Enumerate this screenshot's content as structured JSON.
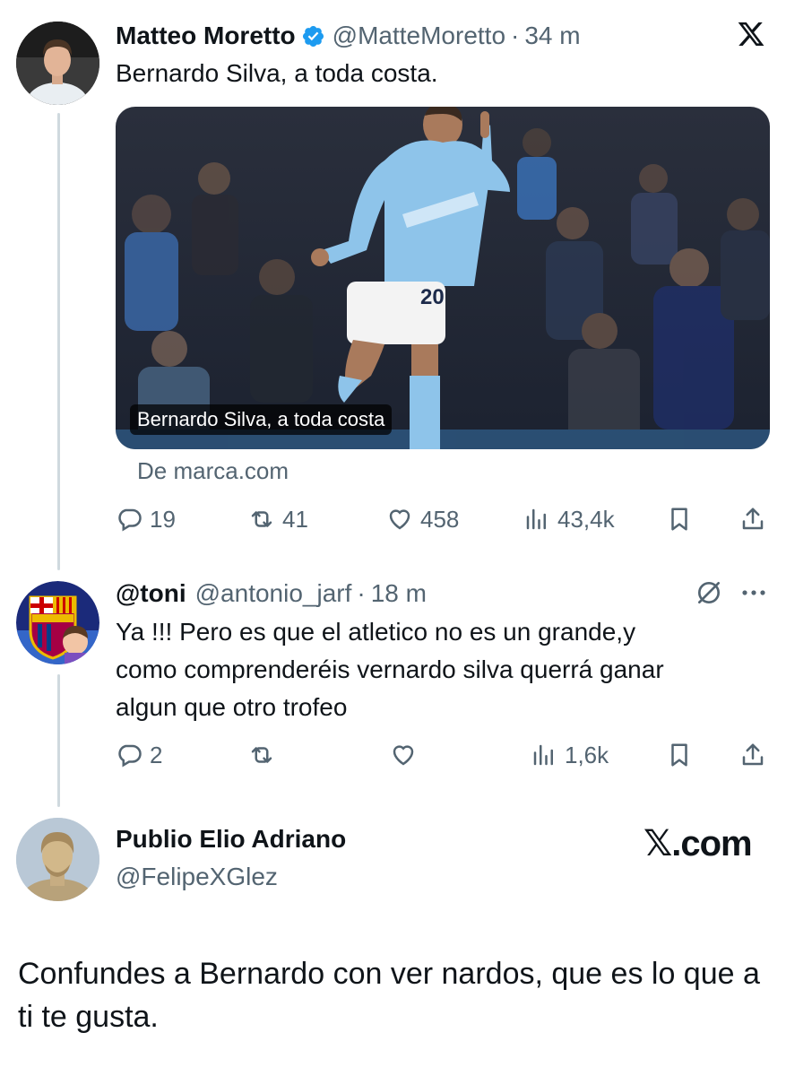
{
  "tweet": {
    "author_name": "Matteo Moretto",
    "handle": "@MatteMoretto",
    "separator": "·",
    "time": "34 m",
    "text": "Bernardo Silva, a toda costa.",
    "media_caption": "Bernardo Silva, a toda costa",
    "source": "De marca.com",
    "stats": {
      "replies": "19",
      "reposts": "41",
      "likes": "458",
      "views": "43,4k"
    },
    "icons": [
      "verified-badge-icon",
      "x-logo-icon",
      "reply-icon",
      "repost-icon",
      "like-icon",
      "views-icon",
      "bookmark-icon",
      "share-icon"
    ]
  },
  "reply": {
    "author_name": "@toni",
    "handle": "@antonio_jarf",
    "separator": "·",
    "time": "18 m",
    "text_lines": [
      "Ya !!! Pero es que el atletico no es un grande,y",
      "como comprenderéis vernardo silva querrá ganar",
      "algun que otro trofeo"
    ],
    "stats": {
      "replies": "2",
      "reposts": "",
      "likes": "",
      "views": "1,6k"
    },
    "icons": [
      "grok-icon",
      "more-icon"
    ]
  },
  "quote_header": {
    "author_name": "Publio Elio Adriano",
    "handle": "@FelipeXGlez",
    "brand": "𝕏.com"
  },
  "final_reply": {
    "text": "Confundes a Bernardo con ver nardos, que es lo que a ti te gusta."
  },
  "colors": {
    "text": "#0f1419",
    "secondary": "#536471",
    "verified": "#1d9bf0",
    "thread_line": "#cfd9de"
  }
}
